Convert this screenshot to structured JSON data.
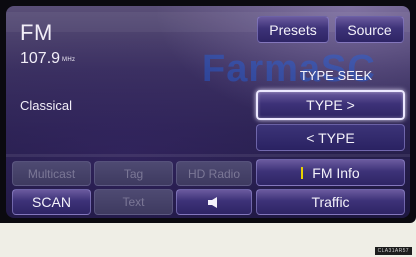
{
  "station": {
    "band": "FM",
    "frequency": "107.9",
    "unit": "MHz",
    "genre": "Classical"
  },
  "top_buttons": {
    "presets": "Presets",
    "source": "Source"
  },
  "watermark": "FarmaSC",
  "type_panel": {
    "type_seek": "TYPE SEEK",
    "type_next": "TYPE >",
    "type_prev": "< TYPE"
  },
  "right_buttons": {
    "fm_info": "FM Info",
    "traffic": "Traffic"
  },
  "bottom_buttons": {
    "multicast": "Multicast",
    "tag": "Tag",
    "hd_radio": "HD Radio",
    "scan": "SCAN",
    "text": "Text",
    "sound": "speaker-icon"
  },
  "caption": "CLA31AR57",
  "colors": {
    "accent_bar": "#e8d200",
    "active_border": "#ece8ff",
    "background": "#efeee6"
  }
}
